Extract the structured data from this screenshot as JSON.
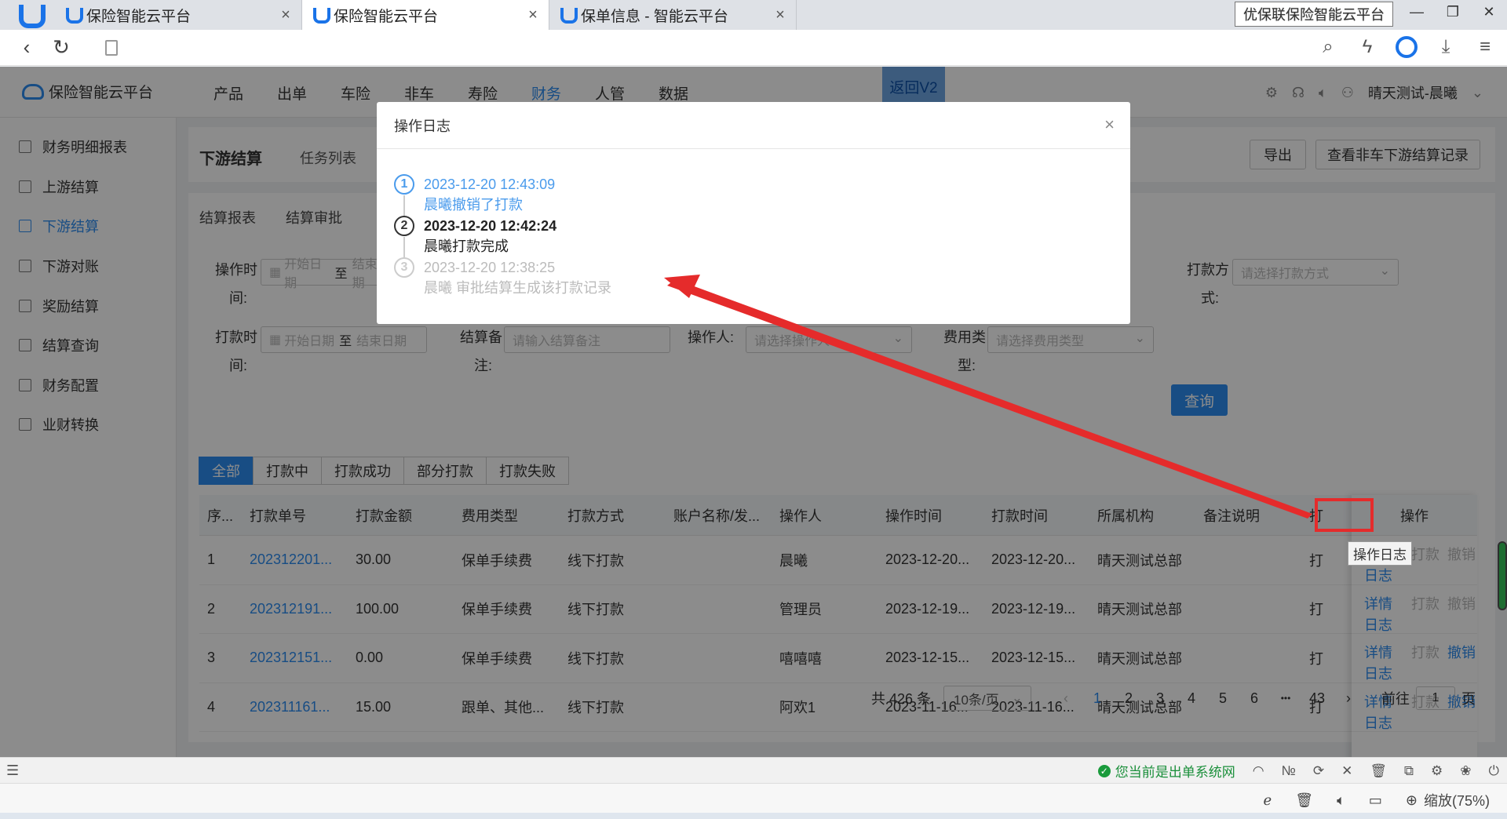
{
  "browser": {
    "tabs": [
      {
        "title": "保险智能云平台",
        "active": false
      },
      {
        "title": "保险智能云平台",
        "active": true
      },
      {
        "title": "保单信息 - 智能云平台",
        "active": false
      }
    ],
    "window_title": "优保联保险智能云平台",
    "zoom": "缩放(75%)"
  },
  "app": {
    "logo_text": "保险智能云平台",
    "nav": [
      "产品",
      "出单",
      "车险",
      "非车",
      "寿险",
      "财务",
      "人管",
      "数据"
    ],
    "active_nav": "财务",
    "back_v2": "返回V2",
    "user": "晴天测试-晨曦"
  },
  "sidebar": {
    "items": [
      {
        "label": "财务明细报表",
        "icon": "report-icon"
      },
      {
        "label": "上游结算",
        "icon": "list-icon"
      },
      {
        "label": "下游结算",
        "icon": "settle-icon",
        "active": true
      },
      {
        "label": "下游对账",
        "icon": "reconcile-icon"
      },
      {
        "label": "奖励结算",
        "icon": "lock-icon"
      },
      {
        "label": "结算查询",
        "icon": "query-icon"
      },
      {
        "label": "财务配置",
        "icon": "config-icon"
      },
      {
        "label": "业财转换",
        "icon": "convert-icon"
      }
    ]
  },
  "page": {
    "title": "下游结算",
    "subtitle": "任务列表",
    "export_btn": "导出",
    "records_btn": "查看非车下游结算记录",
    "sub_tabs": [
      "结算报表",
      "结算审批"
    ]
  },
  "filters": {
    "op_time_label_1": "操作时",
    "op_time_label_2": "间:",
    "start_ph": "开始日期",
    "to": "至",
    "end_ph": "结束日期",
    "pay_method_label_1": "打款方",
    "pay_method_label_2": "式:",
    "pay_method_ph": "请选择打款方式",
    "pay_time_label_1": "打款时",
    "pay_time_label_2": "间:",
    "remark_label_1": "结算备",
    "remark_label_2": "注:",
    "remark_ph": "请输入结算备注",
    "operator_label": "操作人:",
    "operator_ph": "请选择操作人",
    "fee_type_label_1": "费用类",
    "fee_type_label_2": "型:",
    "fee_type_ph": "请选择费用类型",
    "query_btn": "查询"
  },
  "status_tabs": [
    "全部",
    "打款中",
    "打款成功",
    "部分打款",
    "打款失败"
  ],
  "table": {
    "headers": [
      "序...",
      "打款单号",
      "打款金额",
      "费用类型",
      "打款方式",
      "账户名称/发...",
      "操作人",
      "操作时间",
      "打款时间",
      "所属机构",
      "备注说明",
      "打"
    ],
    "ops_header": "操作",
    "rows": [
      {
        "no": "1",
        "code": "202312201...",
        "amount": "30.00",
        "fee": "保单手续费",
        "method": "线下打款",
        "account": "",
        "operator": "晨曦",
        "op_time": "2023-12-20...",
        "pay_time": "2023-12-20...",
        "org": "晴天测试总部",
        "remark": "",
        "extra": "打"
      },
      {
        "no": "2",
        "code": "202312191...",
        "amount": "100.00",
        "fee": "保单手续费",
        "method": "线下打款",
        "account": "",
        "operator": "管理员",
        "op_time": "2023-12-19...",
        "pay_time": "2023-12-19...",
        "org": "晴天测试总部",
        "remark": "",
        "extra": "打"
      },
      {
        "no": "3",
        "code": "202312151...",
        "amount": "0.00",
        "fee": "保单手续费",
        "method": "线下打款",
        "account": "",
        "operator": "嘻嘻嘻",
        "op_time": "2023-12-15...",
        "pay_time": "2023-12-15...",
        "org": "晴天测试总部",
        "remark": "",
        "extra": "打"
      },
      {
        "no": "4",
        "code": "202311161...",
        "amount": "15.00",
        "fee": "跟单、其他...",
        "method": "线下打款",
        "account": "",
        "operator": "阿欢1",
        "op_time": "2023-11-16...",
        "pay_time": "2023-11-16...",
        "org": "晴天测试总部",
        "remark": "",
        "extra": "打"
      }
    ],
    "ops": [
      {
        "detail": "详情",
        "pay": "打款",
        "revoke": "撤销",
        "log": "日志",
        "revoke_enabled": false
      },
      {
        "detail": "详情",
        "pay": "打款",
        "revoke": "撤销",
        "log": "日志",
        "revoke_enabled": false
      },
      {
        "detail": "详情",
        "pay": "打款",
        "revoke": "撤销",
        "log": "日志",
        "revoke_enabled": true
      },
      {
        "detail": "详情",
        "pay": "打款",
        "revoke": "撤销",
        "log": "日志",
        "revoke_enabled": true
      }
    ]
  },
  "pager": {
    "total": "共 426 条",
    "size": "10条/页",
    "pages": [
      "1",
      "2",
      "3",
      "4",
      "5",
      "6",
      "•••",
      "43"
    ],
    "active": "1",
    "goto_label": "前往",
    "goto_value": "1",
    "page_unit": "页"
  },
  "tooltip": "操作日志",
  "modal": {
    "title": "操作日志",
    "logs": [
      {
        "num": "1",
        "time": "2023-12-20 12:43:09",
        "desc": "晨曦撤销了打款",
        "state": "current"
      },
      {
        "num": "2",
        "time": "2023-12-20 12:42:24",
        "desc": "晨曦打款完成",
        "state": "done"
      },
      {
        "num": "3",
        "time": "2023-12-20 12:38:25",
        "desc": "晨曦 审批结算生成该打款记录",
        "state": "old"
      }
    ]
  },
  "statusbar": {
    "system_text": "您当前是出单系统网"
  },
  "colors": {
    "primary": "#2d8cf0",
    "highlight": "#e52b2b",
    "success": "#1a9b3c"
  }
}
